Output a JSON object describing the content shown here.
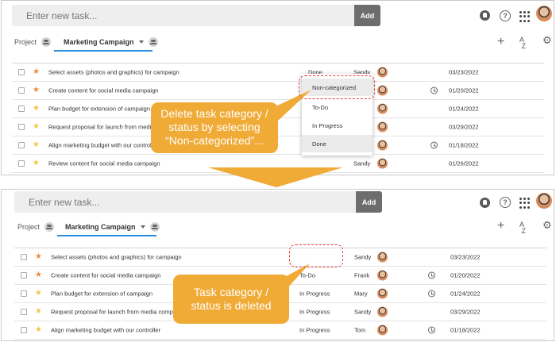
{
  "colors": {
    "accent_blue": "#2b8ee0",
    "callout_orange": "#f0aa36",
    "highlight_red": "#e23a3a",
    "star_orange": "#ef8a3c",
    "star_yellow": "#f2c744"
  },
  "header": {
    "input_placeholder": "Enter new task...",
    "add_label": "Add",
    "icons": [
      "bell-icon",
      "help-icon",
      "apps-icon",
      "avatar"
    ]
  },
  "tabs": {
    "project": "Project",
    "marketing": "Marketing Campaign"
  },
  "top": {
    "rows": [
      {
        "star": "orange",
        "title": "Select assets (photos and graphics) for campaign",
        "status": "Done",
        "assignee": "Sandy",
        "reminder": false,
        "date": "03/23/2022"
      },
      {
        "star": "orange",
        "title": "Create content for social media campaign",
        "status": "",
        "assignee": "",
        "reminder": true,
        "date": "01/20/2022"
      },
      {
        "star": "yellow",
        "title": "Plan budget for extension of campaign",
        "status": "",
        "assignee": "",
        "reminder": false,
        "date": "01/24/2022"
      },
      {
        "star": "yellow",
        "title": "Request proposal for launch from media",
        "status": "",
        "assignee": "",
        "reminder": false,
        "date": "03/29/2022"
      },
      {
        "star": "yellow",
        "title": "Align marketing budget with our control",
        "status": "",
        "assignee": "",
        "reminder": true,
        "date": "01/18/2022"
      },
      {
        "star": "yellow",
        "title": "Review content for social media campaign",
        "status": "",
        "assignee": "Sandy",
        "reminder": false,
        "date": "01/26/2022"
      }
    ],
    "dropdown": [
      "Non-categorized",
      "To-Do",
      "In Progress",
      "Done"
    ],
    "callout_lines": [
      "Delete task category /",
      "status by selecting",
      "“Non-categorized”..."
    ]
  },
  "bottom": {
    "rows": [
      {
        "star": "orange",
        "title": "Select assets (photos and graphics) for campaign",
        "status": "",
        "assignee": "Sandy",
        "reminder": false,
        "date": "03/23/2022"
      },
      {
        "star": "orange",
        "title": "Create content for social media campaign",
        "status": "To-Do",
        "assignee": "Frank",
        "reminder": true,
        "date": "01/20/2022"
      },
      {
        "star": "yellow",
        "title": "Plan budget for extension of campaign",
        "status": "In Progress",
        "assignee": "Mary",
        "reminder": true,
        "date": "01/24/2022"
      },
      {
        "star": "yellow",
        "title": "Request proposal for launch from media comp",
        "status": "In Progress",
        "assignee": "Sandy",
        "reminder": false,
        "date": "03/29/2022"
      },
      {
        "star": "yellow",
        "title": "Align marketing budget with our controller",
        "status": "In Progress",
        "assignee": "Tom",
        "reminder": true,
        "date": "01/18/2022"
      }
    ],
    "callout_lines": [
      "Task category /",
      "status is deleted"
    ]
  }
}
